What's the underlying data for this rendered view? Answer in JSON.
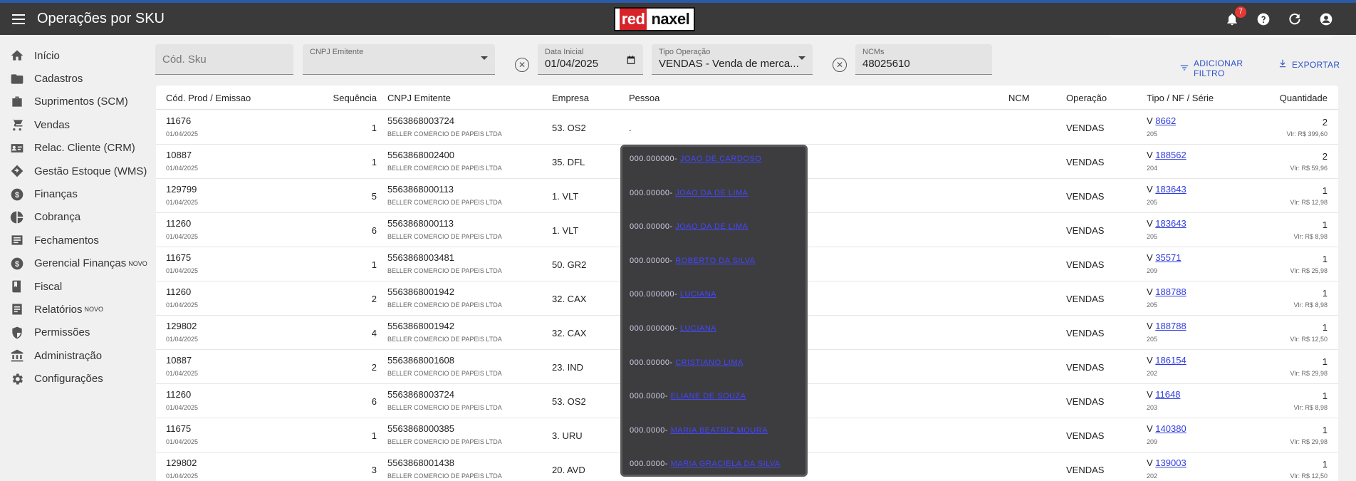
{
  "app": {
    "title": "Operações por SKU",
    "notif_count": "7",
    "logo_red": "red",
    "logo_rest": "naxel"
  },
  "nav": [
    {
      "label": "Início",
      "icon": "home-icon",
      "badge": ""
    },
    {
      "label": "Cadastros",
      "icon": "folder-icon",
      "badge": ""
    },
    {
      "label": "Suprimentos (SCM)",
      "icon": "briefcase-icon",
      "badge": ""
    },
    {
      "label": "Vendas",
      "icon": "cart-icon",
      "badge": ""
    },
    {
      "label": "Relac. Cliente (CRM)",
      "icon": "contact-card-icon",
      "badge": ""
    },
    {
      "label": "Gestão Estoque (WMS)",
      "icon": "diamond-arrow-icon",
      "badge": ""
    },
    {
      "label": "Finanças",
      "icon": "dollar-circle-icon",
      "badge": ""
    },
    {
      "label": "Cobrança",
      "icon": "pie-icon",
      "badge": ""
    },
    {
      "label": "Fechamentos",
      "icon": "list-box-icon",
      "badge": ""
    },
    {
      "label": "Gerencial Finanças",
      "icon": "dollar-circle-icon",
      "badge": "NOVO"
    },
    {
      "label": "Fiscal",
      "icon": "book-icon",
      "badge": ""
    },
    {
      "label": "Relatórios",
      "icon": "report-icon",
      "badge": "NOVO"
    },
    {
      "label": "Permissões",
      "icon": "shield-icon",
      "badge": ""
    },
    {
      "label": "Administração",
      "icon": "bank-icon",
      "badge": ""
    },
    {
      "label": "Configurações",
      "icon": "gear-icon",
      "badge": ""
    }
  ],
  "filters": {
    "sku_placeholder": "Cód. Sku",
    "cnpj_label": "CNPJ Emitente",
    "data_label": "Data Inicial",
    "data_value": "01/04/2025",
    "tipo_label": "Tipo Operação",
    "tipo_value": "VENDAS - Venda de merca...",
    "ncm_label": "NCMs",
    "ncm_value": "48025610",
    "add_filter": "ADICIONAR FILTRO",
    "export": "EXPORTAR"
  },
  "table": {
    "headers": {
      "cod": "Cód. Prod / Emissao",
      "seq": "Sequência",
      "cnpj": "CNPJ Emitente",
      "empresa": "Empresa",
      "pessoa": "Pessoa",
      "ncm": "NCM",
      "operacao": "Operação",
      "tipo": "Tipo / NF / Série",
      "qtd": "Quantidade"
    },
    "rows": [
      {
        "cod": "11676",
        "date": "01/04/2025",
        "seq": "1",
        "cnpj": "5563868003724",
        "razao": "BELLER COMERCIO DE PAPEIS LTDA",
        "empresa": "53. OS2",
        "pessoa": ".",
        "op": "VENDAS",
        "tipo": "V",
        "nf": "8662",
        "serie": "205",
        "qtd": "2",
        "vlr": "Vlr: R$ 399,60"
      },
      {
        "cod": "10887",
        "date": "01/04/2025",
        "seq": "1",
        "cnpj": "5563868002400",
        "razao": "BELLER COMERCIO DE PAPEIS LTDA",
        "empresa": "35. DFL",
        "pessoa": "",
        "op": "VENDAS",
        "tipo": "V",
        "nf": "188562",
        "serie": "204",
        "qtd": "2",
        "vlr": "Vlr: R$ 59,96"
      },
      {
        "cod": "129799",
        "date": "01/04/2025",
        "seq": "5",
        "cnpj": "5563868000113",
        "razao": "BELLER COMERCIO DE PAPEIS LTDA",
        "empresa": "1. VLT",
        "pessoa": "",
        "op": "VENDAS",
        "tipo": "V",
        "nf": "183643",
        "serie": "205",
        "qtd": "1",
        "vlr": "Vlr: R$ 12,98"
      },
      {
        "cod": "11260",
        "date": "01/04/2025",
        "seq": "6",
        "cnpj": "5563868000113",
        "razao": "BELLER COMERCIO DE PAPEIS LTDA",
        "empresa": "1. VLT",
        "pessoa": "",
        "op": "VENDAS",
        "tipo": "V",
        "nf": "183643",
        "serie": "205",
        "qtd": "1",
        "vlr": "Vlr: R$ 8,98"
      },
      {
        "cod": "11675",
        "date": "01/04/2025",
        "seq": "1",
        "cnpj": "5563868003481",
        "razao": "BELLER COMERCIO DE PAPEIS LTDA",
        "empresa": "50. GR2",
        "pessoa": "",
        "op": "VENDAS",
        "tipo": "V",
        "nf": "35571",
        "serie": "209",
        "qtd": "1",
        "vlr": "Vlr: R$ 25,98"
      },
      {
        "cod": "11260",
        "date": "01/04/2025",
        "seq": "2",
        "cnpj": "5563868001942",
        "razao": "BELLER COMERCIO DE PAPEIS LTDA",
        "empresa": "32. CAX",
        "pessoa": "",
        "op": "VENDAS",
        "tipo": "V",
        "nf": "188788",
        "serie": "205",
        "qtd": "1",
        "vlr": "Vlr: R$ 8,98"
      },
      {
        "cod": "129802",
        "date": "01/04/2025",
        "seq": "4",
        "cnpj": "5563868001942",
        "razao": "BELLER COMERCIO DE PAPEIS LTDA",
        "empresa": "32. CAX",
        "pessoa": "",
        "op": "VENDAS",
        "tipo": "V",
        "nf": "188788",
        "serie": "205",
        "qtd": "1",
        "vlr": "Vlr: R$ 12,50"
      },
      {
        "cod": "10887",
        "date": "01/04/2025",
        "seq": "2",
        "cnpj": "5563868001608",
        "razao": "BELLER COMERCIO DE PAPEIS LTDA",
        "empresa": "23. IND",
        "pessoa": "",
        "op": "VENDAS",
        "tipo": "V",
        "nf": "186154",
        "serie": "202",
        "qtd": "1",
        "vlr": "Vlr: R$ 29,98"
      },
      {
        "cod": "11260",
        "date": "01/04/2025",
        "seq": "6",
        "cnpj": "5563868003724",
        "razao": "BELLER COMERCIO DE PAPEIS LTDA",
        "empresa": "53. OS2",
        "pessoa": "",
        "op": "VENDAS",
        "tipo": "V",
        "nf": "11648",
        "serie": "203",
        "qtd": "1",
        "vlr": "Vlr: R$ 8,98"
      },
      {
        "cod": "11675",
        "date": "01/04/2025",
        "seq": "1",
        "cnpj": "5563868000385",
        "razao": "BELLER COMERCIO DE PAPEIS LTDA",
        "empresa": "3. URU",
        "pessoa": "",
        "op": "VENDAS",
        "tipo": "V",
        "nf": "140380",
        "serie": "209",
        "qtd": "1",
        "vlr": "Vlr: R$ 29,98"
      },
      {
        "cod": "129802",
        "date": "01/04/2025",
        "seq": "3",
        "cnpj": "5563868001438",
        "razao": "BELLER COMERCIO DE PAPEIS LTDA",
        "empresa": "20. AVD",
        "pessoa": "",
        "op": "VENDAS",
        "tipo": "V",
        "nf": "139003",
        "serie": "202",
        "qtd": "1",
        "vlr": "Vlr: R$ 12,50"
      }
    ]
  },
  "tooltip": {
    "lines": [
      {
        "pre": "000.000000-",
        "name": "JOAO DE CARDOSO"
      },
      {
        "pre": "000.00000-",
        "name": "JOAO DA DE LIMA"
      },
      {
        "pre": "000.00000-",
        "name": "JOAO DA DE LIMA"
      },
      {
        "pre": "000.00000-",
        "name": "ROBERTO DA SILVA"
      },
      {
        "pre": "000.000000-",
        "name": "LUCIANA"
      },
      {
        "pre": "000.000000-",
        "name": "LUCIANA"
      },
      {
        "pre": "000.00000-",
        "name": "CRISTIANO LIMA"
      },
      {
        "pre": "000.0000-",
        "name": "ELIANE DE SOUZA"
      },
      {
        "pre": "000.0000-",
        "name": "MARIA BEATRIZ MOURA"
      },
      {
        "pre": "000.0000-",
        "name": "MARIA GRACIELA DA SILVA"
      }
    ]
  }
}
